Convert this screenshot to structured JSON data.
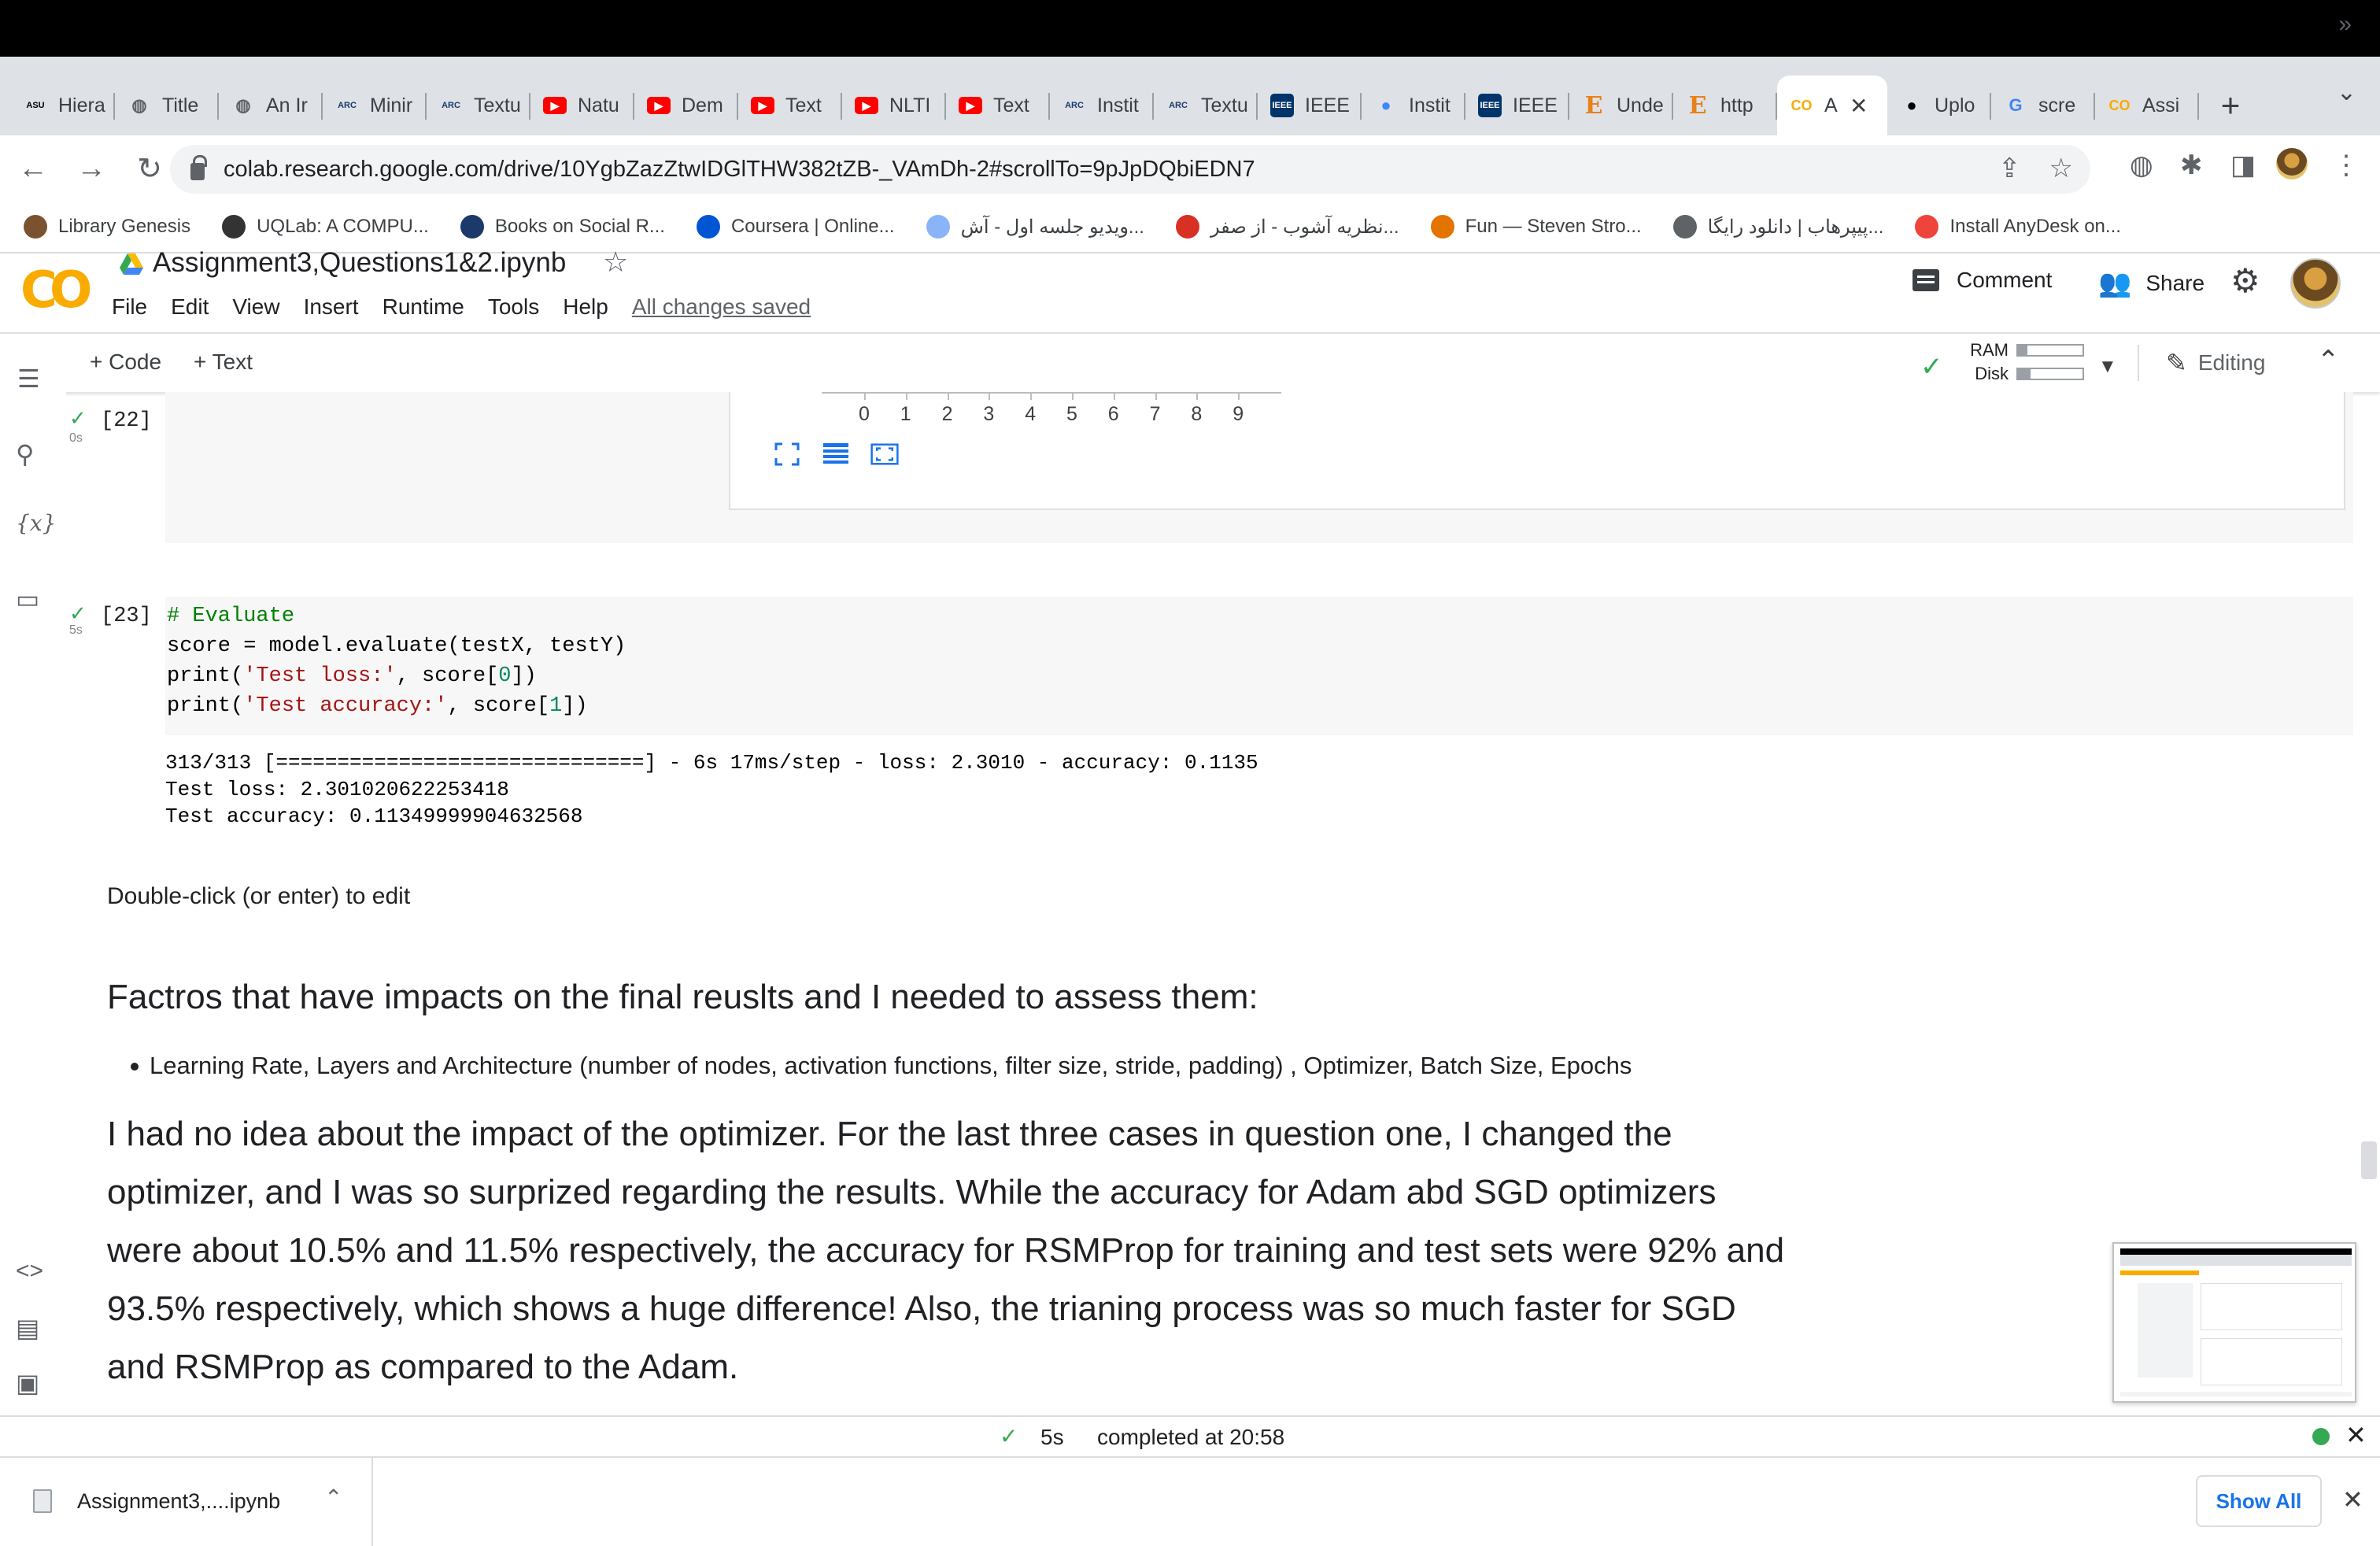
{
  "browser": {
    "tabs": [
      {
        "label": "Hiera",
        "icon": "asu-icon",
        "color": "#000000",
        "glyph": "ASU"
      },
      {
        "label": "Title",
        "icon": "globe-icon",
        "color": "#5f6368",
        "glyph": "◍"
      },
      {
        "label": "An Ir",
        "icon": "globe-icon",
        "color": "#5f6368",
        "glyph": "◍"
      },
      {
        "label": "Minir",
        "icon": "arc-icon",
        "color": "#1b3a6b",
        "glyph": "ARC"
      },
      {
        "label": "Textu",
        "icon": "arc-icon",
        "color": "#1b3a6b",
        "glyph": "ARC"
      },
      {
        "label": "Natu",
        "icon": "youtube-icon",
        "color": "#ff0000",
        "glyph": "▶"
      },
      {
        "label": "Dem",
        "icon": "youtube-icon",
        "color": "#ff0000",
        "glyph": "▶"
      },
      {
        "label": "Text",
        "icon": "youtube-icon",
        "color": "#ff0000",
        "glyph": "▶"
      },
      {
        "label": "NLTI",
        "icon": "youtube-icon",
        "color": "#ff0000",
        "glyph": "▶"
      },
      {
        "label": "Text",
        "icon": "youtube-icon",
        "color": "#ff0000",
        "glyph": "▶"
      },
      {
        "label": "Instit",
        "icon": "arc-icon",
        "color": "#1b3a6b",
        "glyph": "ARC"
      },
      {
        "label": "Textu",
        "icon": "arc-icon",
        "color": "#1b3a6b",
        "glyph": "ARC"
      },
      {
        "label": "IEEE",
        "icon": "ieee-icon",
        "color": "#00356b",
        "glyph": "IEEE"
      },
      {
        "label": "Instit",
        "icon": "google-icon",
        "color": "#4285f4",
        "glyph": "●"
      },
      {
        "label": "IEEE",
        "icon": "ieee-icon",
        "color": "#00356b",
        "glyph": "IEEE"
      },
      {
        "label": "Unde",
        "icon": "e-icon",
        "color": "#e8811a",
        "glyph": "E"
      },
      {
        "label": "http",
        "icon": "e-icon",
        "color": "#e8811a",
        "glyph": "E"
      },
      {
        "label": "A",
        "icon": "colab-icon",
        "color": "#f9ab00",
        "glyph": "CO",
        "active": true
      },
      {
        "label": "Uplo",
        "icon": "github-icon",
        "color": "#000000",
        "glyph": "●"
      },
      {
        "label": "scre",
        "icon": "google-g-icon",
        "color": "#4285f4",
        "glyph": "G"
      },
      {
        "label": "Assi",
        "icon": "colab-icon",
        "color": "#f9ab00",
        "glyph": "CO"
      }
    ],
    "url": "colab.research.google.com/drive/10YgbZazZtwIDGlTHW382tZB-_VAmDh-2#scrollTo=9pJpDQbiEDN7",
    "bookmarks": [
      {
        "label": "Library Genesis",
        "color": "#7a5230"
      },
      {
        "label": "UQLab: A COMPU...",
        "color": "#333333"
      },
      {
        "label": "Books on Social R...",
        "color": "#1b3a6b"
      },
      {
        "label": "Coursera | Online...",
        "color": "#0056d2"
      },
      {
        "label": "ویدیو جلسه اول - آش...",
        "color": "#8ab4f8"
      },
      {
        "label": "نظریه آشوب - از صفر...",
        "color": "#d93025"
      },
      {
        "label": "Fun — Steven Stro...",
        "color": "#e37400"
      },
      {
        "label": "پیپرهاب | دانلود رایگا...",
        "color": "#5f6368"
      },
      {
        "label": "Install AnyDesk on...",
        "color": "#ef443b"
      }
    ]
  },
  "colab": {
    "logo": "CO",
    "notebook_title": "Assignment3,Questions1&2.ipynb",
    "menu": [
      "File",
      "Edit",
      "View",
      "Insert",
      "Runtime",
      "Tools",
      "Help"
    ],
    "save_status": "All changes saved",
    "comment_label": "Comment",
    "share_label": "Share",
    "toolbar": {
      "add_code": "+ Code",
      "add_text": "+ Text",
      "ram_label": "RAM",
      "disk_label": "Disk",
      "ram_usage": 0.15,
      "disk_usage": 0.2,
      "editing_label": "Editing"
    }
  },
  "cells": {
    "cell22": {
      "exec_count": "[22]",
      "run_time": "0s",
      "axis_ticks": [
        "0",
        "1",
        "2",
        "3",
        "4",
        "5",
        "6",
        "7",
        "8",
        "9"
      ]
    },
    "cell23": {
      "exec_count": "[23]",
      "run_time": "5s",
      "code": {
        "line1": "# Evaluate",
        "line2": "score = model.evaluate(testX, testY)",
        "line3_a": "print(",
        "line3_str": "'Test loss:'",
        "line3_b": ", score[",
        "line3_num": "0",
        "line3_c": "])",
        "line4_a": "print(",
        "line4_str": "'Test accuracy:'",
        "line4_b": ", score[",
        "line4_num": "1",
        "line4_c": "])"
      },
      "output": [
        "313/313 [==============================] - 6s 17ms/step - loss: 2.3010 - accuracy: 0.1135",
        "Test loss: 2.301020622253418",
        "Test accuracy: 0.11349999904632568"
      ]
    },
    "text_cell": {
      "hint": "Double-click (or enter) to edit",
      "heading": "Factros that have impacts on the final reuslts and I needed to assess them:",
      "bullet": "Learning Rate, Layers and Architecture (number of nodes, activation functions, filter size, stride, padding) , Optimizer, Batch Size, Epochs",
      "paragraph": "I had no idea about the impact of the optimizer. For the last three cases in question one, I changed the optimizer, and I was so surprized regarding the results. While the accuracy for Adam abd SGD optimizers were about 10.5% and 11.5% respectively, the accuracy for RSMProp for training and test sets were 92% and 93.5% respectively, which shows a huge difference! Also, the trianing process was so much faster for SGD and RSMProp as compared to the Adam."
    }
  },
  "status": {
    "duration": "5s",
    "text": "completed at 20:58"
  },
  "download": {
    "filename": "Assignment3,....ipynb",
    "show_all": "Show All"
  },
  "colors": {
    "accent": "#f9ab00",
    "success": "#34a853",
    "link": "#1a73e8"
  }
}
